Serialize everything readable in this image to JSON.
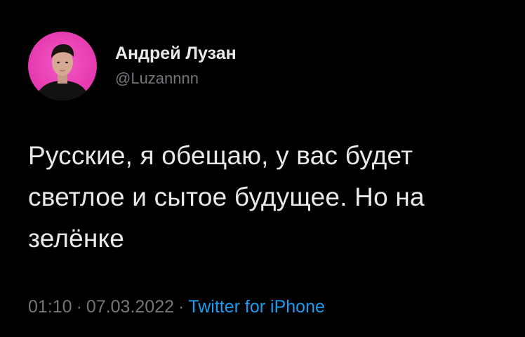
{
  "user": {
    "display_name": "Андрей Лузан",
    "handle": "@Luzannnn",
    "avatar_bg": "#e83cb2"
  },
  "tweet": {
    "text": "Русские, я обещаю, у вас будет светлое и сытое будущее. Но на зелёнке",
    "time": "01:10",
    "date": "07.03.2022",
    "separator": "·",
    "source": "Twitter for iPhone"
  },
  "colors": {
    "background": "#000000",
    "text": "#e7e9ea",
    "secondary": "#71767b",
    "link": "#1d9bf0"
  }
}
